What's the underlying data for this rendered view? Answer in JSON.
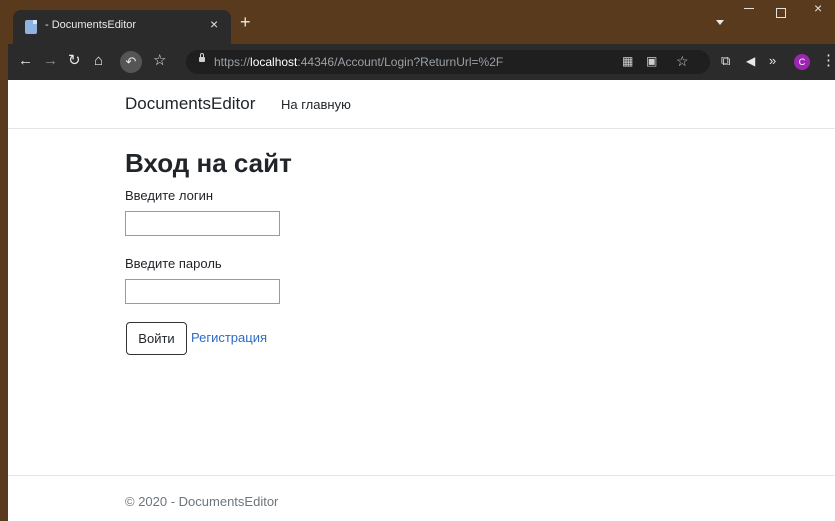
{
  "browser": {
    "tab_title": "- DocumentsEditor",
    "tab_close": "×",
    "new_tab": "+",
    "win_close": "×",
    "url_scheme": "https://",
    "url_host": "localhost",
    "url_rest": ":44346/Account/Login?ReturnUrl=%2F",
    "profile_initial": "C",
    "icons": [
      "back-icon",
      "forward-icon",
      "reload-icon",
      "home-icon",
      "undo-icon",
      "star-icon",
      "lock-icon",
      "qr-icon",
      "translate-icon",
      "bookmark-star-icon",
      "crop-icon",
      "speaker-icon",
      "chevrons-icon",
      "menu-icon"
    ]
  },
  "nav": {
    "brand": "DocumentsEditor",
    "home_link": "На главную"
  },
  "main": {
    "title": "Вход на сайт",
    "login_label": "Введите логин",
    "login_value": "",
    "password_label": "Введите пароль",
    "password_value": "",
    "submit_label": "Войти",
    "register_label": "Регистрация"
  },
  "footer": {
    "text": "© 2020 - DocumentsEditor"
  }
}
